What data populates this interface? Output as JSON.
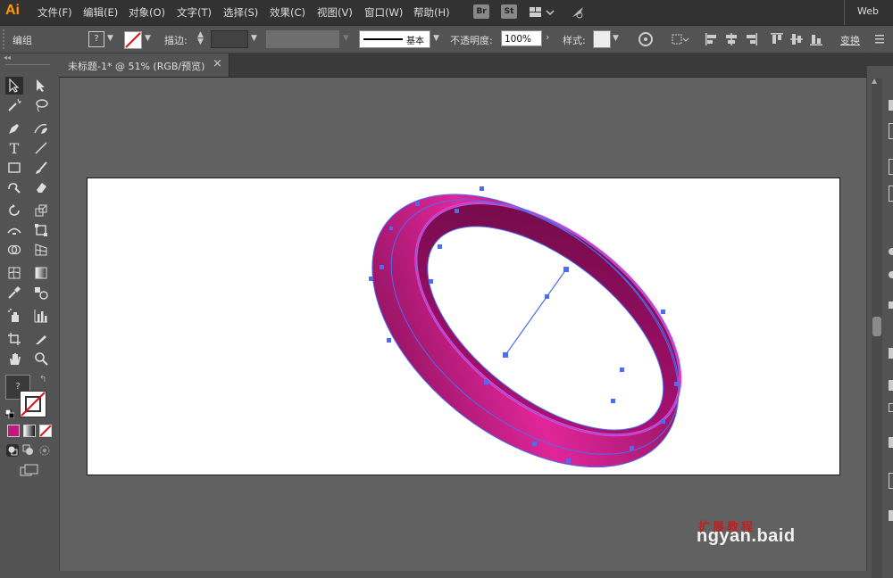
{
  "app": {
    "logo": "Ai"
  },
  "menubar": {
    "items": [
      "文件(F)",
      "编辑(E)",
      "对象(O)",
      "文字(T)",
      "选择(S)",
      "效果(C)",
      "视图(V)",
      "窗口(W)",
      "帮助(H)"
    ],
    "badge_br": "Br",
    "badge_st": "St",
    "workspace": "Web"
  },
  "controlbar": {
    "selection_label": "编组",
    "stroke_label": "描边:",
    "stroke_profile": "基本",
    "opacity_label": "不透明度:",
    "opacity_value": "100%",
    "style_label": "样式:",
    "transform_label": "变换"
  },
  "document": {
    "tab_title": "未标题-1* @ 51% (RGB/预览)",
    "close_glyph": "×"
  },
  "toolbar": {
    "collapse_glyph": "◂◂",
    "fill_color": "#c2177f",
    "accent": "#ff9a00"
  },
  "artwork": {
    "ring_color_light": "#e0269a",
    "ring_color_dark": "#7a0d4e",
    "selection_color": "#4d6cf0"
  },
  "watermark": {
    "text": "ngyan.baid",
    "top_text": "扩展教程"
  }
}
